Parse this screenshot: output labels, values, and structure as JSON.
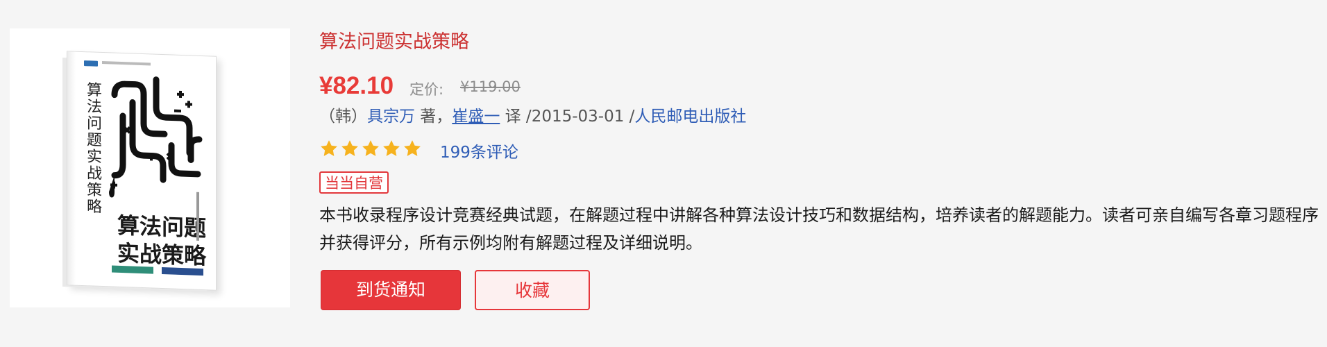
{
  "product": {
    "title": "算法问题实战策略",
    "price": "¥82.10",
    "list_price_label": "定价:",
    "list_price": "¥119.00",
    "author_prefix": "（韩）",
    "author": "具宗万",
    "author_role": " 著，",
    "translator": "崔盛一",
    "translator_role": " 译 /",
    "date": "2015-03-01",
    "sep": " /",
    "publisher": "人民邮电出版社",
    "rating_stars": 5,
    "reviews": "199条评论",
    "badge": "当当自营",
    "description": "本书收录程序设计竞赛经典试题，在解题过程中讲解各种算法设计技巧和数据结构，培养读者的解题能力。读者可亲自编写各章习题程序并获得评分，所有示例均附有解题过程及详细说明。"
  },
  "cover": {
    "vertical_title": "算法问题实战策略",
    "title_line1": "算法问题",
    "title_line2": "实战策略"
  },
  "buttons": {
    "notify": "到货通知",
    "favorite": "收藏"
  },
  "colors": {
    "accent_red": "#e6363a",
    "link_blue": "#2f5db6",
    "star_gold": "#f6b21e"
  }
}
